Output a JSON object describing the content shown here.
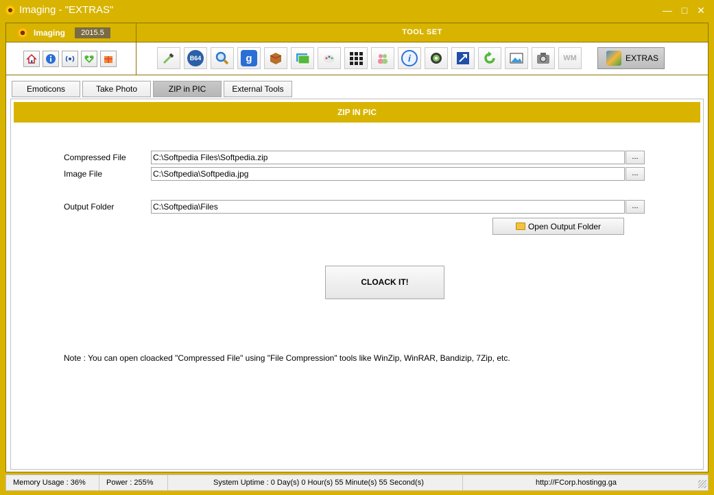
{
  "window": {
    "title": "Imaging - \"EXTRAS\"",
    "minimize": "—",
    "maximize": "□",
    "close": "✕"
  },
  "brand": {
    "name": "Imaging",
    "version": "2015.5"
  },
  "toolset": {
    "title": "TOOL SET",
    "extras_label": "EXTRAS",
    "b64": "B64",
    "google": "g",
    "wm": "WM",
    "info": "i"
  },
  "left_buttons": [
    {
      "icon": "home-icon"
    },
    {
      "icon": "info-icon"
    },
    {
      "icon": "broadcast-icon"
    },
    {
      "icon": "heart-plus-icon"
    },
    {
      "icon": "gift-icon"
    }
  ],
  "tabs": [
    {
      "label": "Emoticons"
    },
    {
      "label": "Take Photo"
    },
    {
      "label": "ZIP in PIC",
      "active": true
    },
    {
      "label": "External Tools"
    }
  ],
  "panel": {
    "header": "ZIP IN PIC",
    "compressed_label": "Compressed File",
    "compressed_value": "C:\\Softpedia Files\\Softpedia.zip",
    "image_label": "Image File",
    "image_value": "C:\\Softpedia\\Softpedia.jpg",
    "output_label": "Output Folder",
    "output_value": "C:\\Softpedia\\Files",
    "browse_label": "...",
    "open_output_label": "Open Output Folder",
    "cloack_label": "CLOACK IT!",
    "note": "Note : You can open cloacked \"Compressed File\" using \"File Compression\" tools like WinZip, WinRAR, Bandizip, 7Zip, etc."
  },
  "status": {
    "memory": "Memory Usage : 36%",
    "power": "Power : 255%",
    "uptime": "System Uptime : 0 Day(s) 0 Hour(s) 55 Minute(s) 55 Second(s)",
    "url": "http://FCorp.hostingg.ga"
  }
}
